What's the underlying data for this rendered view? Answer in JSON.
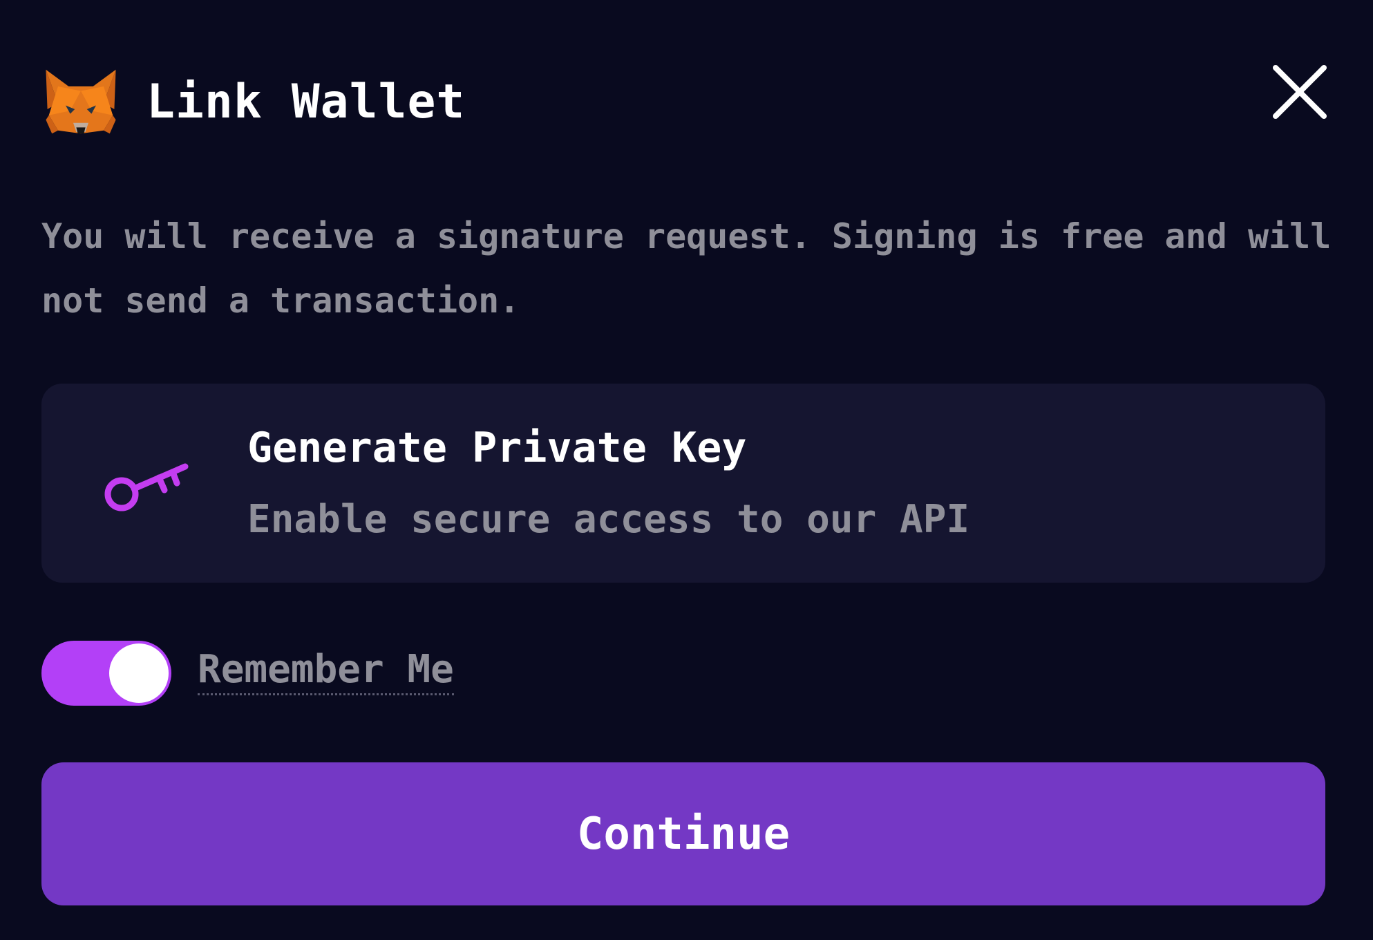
{
  "dialog": {
    "title": "Link Wallet",
    "logo_icon": "metamask-fox-icon",
    "close_icon": "close-icon",
    "description": "You will receive a signature request. Signing is free and will not send a transaction."
  },
  "option": {
    "icon": "key-icon",
    "title": "Generate Private Key",
    "subtitle": "Enable secure access to our API"
  },
  "remember": {
    "label": "Remember Me",
    "enabled": true
  },
  "continue_button": {
    "label": "Continue"
  },
  "colors": {
    "background": "#090a1f",
    "card": "#151530",
    "accent_purple": "#7438c5",
    "toggle_magenta": "#b340f7",
    "muted_text": "#8f8f99"
  }
}
